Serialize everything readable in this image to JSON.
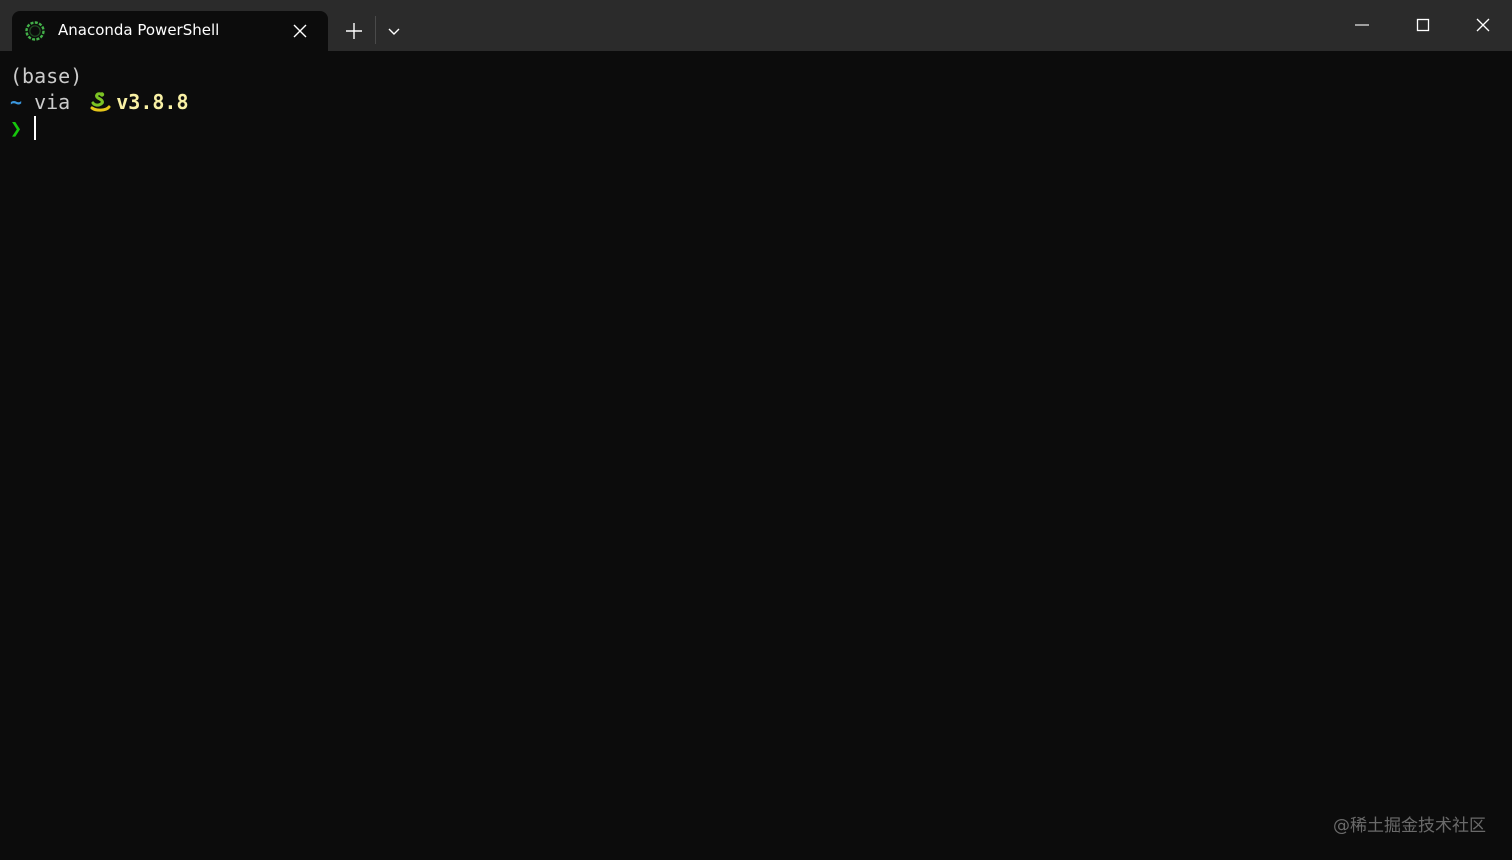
{
  "tab": {
    "title": "Anaconda PowerShell",
    "icon": "anaconda-ring-icon",
    "icon_color": "#43b049"
  },
  "titlebar_buttons": {
    "new_tab": "plus-icon",
    "dropdown": "chevron-down-icon",
    "minimize": "minimize-icon",
    "maximize": "maximize-icon",
    "close": "close-icon"
  },
  "terminal": {
    "env_line": "(base)",
    "prompt_line": {
      "tilde": "~",
      "via": " via ",
      "python_icon": "snake-icon",
      "version": "v3.8.8"
    },
    "prompt_char": "❯",
    "colors": {
      "background": "#0c0c0c",
      "text": "#cccccc",
      "tilde": "#3a96dd",
      "version": "#f9f1a5",
      "prompt": "#16c60c"
    }
  },
  "watermark": "@稀土掘金技术社区"
}
